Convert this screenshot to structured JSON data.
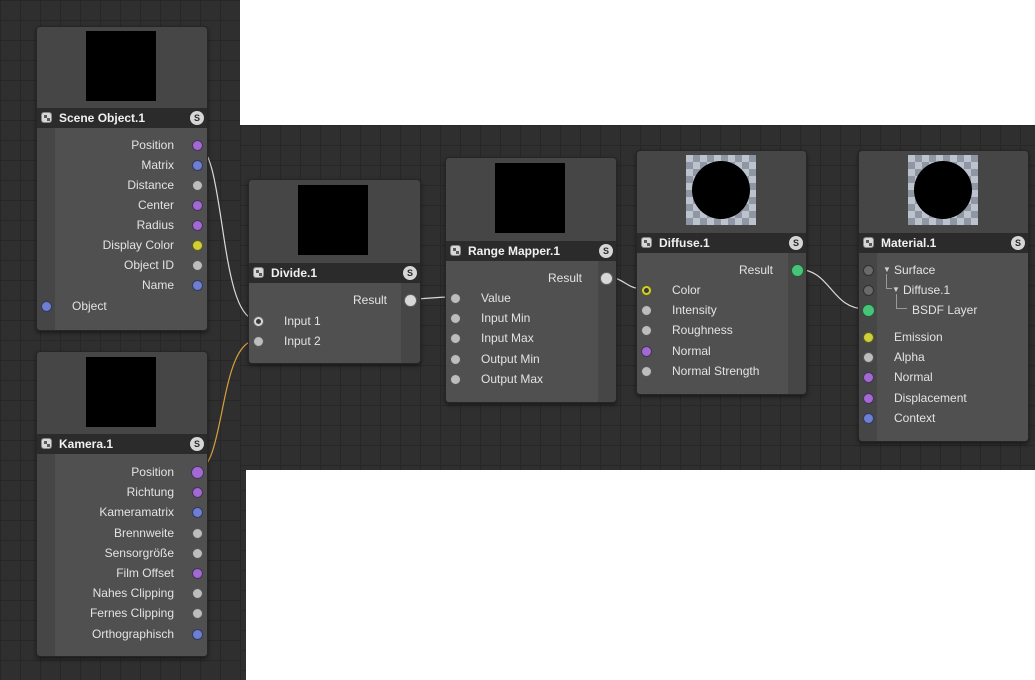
{
  "colors": {
    "port_purple": "#a06ad0",
    "port_blue": "#6e7ed0",
    "port_gray": "#bdbdbd",
    "port_yellow": "#cfcf3a",
    "port_green": "#48c47a",
    "wire_light": "#d9d9d9",
    "wire_orange": "#d9a03a",
    "node_bg": "#464646",
    "header_bg": "#2b2b2b",
    "canvas_bg": "#2f2f2f"
  },
  "nodes": {
    "scene_object": {
      "title": "Scene Object.1",
      "solo_label": "S",
      "icon": "node-type-icon",
      "outputs": [
        {
          "label": "Position",
          "color": "#a06ad0"
        },
        {
          "label": "Matrix",
          "color": "#6e7ed0"
        },
        {
          "label": "Distance",
          "color": "#bdbdbd"
        },
        {
          "label": "Center",
          "color": "#a06ad0"
        },
        {
          "label": "Radius",
          "color": "#a06ad0"
        },
        {
          "label": "Display Color",
          "color": "#cfcf3a"
        },
        {
          "label": "Object ID",
          "color": "#bdbdbd"
        },
        {
          "label": "Name",
          "color": "#6e7ed0"
        }
      ],
      "inputs": [
        {
          "label": "Object",
          "color": "#6e7ed0"
        }
      ]
    },
    "kamera": {
      "title": "Kamera.1",
      "solo_label": "S",
      "outputs": [
        {
          "label": "Position",
          "color": "#a06ad0",
          "big": true
        },
        {
          "label": "Richtung",
          "color": "#a06ad0"
        },
        {
          "label": "Kameramatrix",
          "color": "#6e7ed0"
        },
        {
          "label": "Brennweite",
          "color": "#bdbdbd"
        },
        {
          "label": "Sensorgröße",
          "color": "#bdbdbd"
        },
        {
          "label": "Film Offset",
          "color": "#a06ad0"
        },
        {
          "label": "Nahes Clipping",
          "color": "#bdbdbd"
        },
        {
          "label": "Fernes Clipping",
          "color": "#bdbdbd"
        },
        {
          "label": "Orthographisch",
          "color": "#6e7ed0"
        }
      ]
    },
    "divide": {
      "title": "Divide.1",
      "solo_label": "S",
      "result_label": "Result",
      "inputs": [
        {
          "label": "Input 1",
          "color": "#d8d8d8",
          "ring": true
        },
        {
          "label": "Input 2",
          "color": "#bdbdbd"
        }
      ]
    },
    "range_mapper": {
      "title": "Range Mapper.1",
      "solo_label": "S",
      "result_label": "Result",
      "inputs": [
        {
          "label": "Value",
          "color": "#bdbdbd"
        },
        {
          "label": "Input Min",
          "color": "#bdbdbd"
        },
        {
          "label": "Input Max",
          "color": "#bdbdbd"
        },
        {
          "label": "Output Min",
          "color": "#bdbdbd"
        },
        {
          "label": "Output Max",
          "color": "#bdbdbd"
        }
      ]
    },
    "diffuse": {
      "title": "Diffuse.1",
      "solo_label": "S",
      "result_label": "Result",
      "inputs": [
        {
          "label": "Color",
          "color": "#cfcf3a",
          "ring": true
        },
        {
          "label": "Intensity",
          "color": "#bdbdbd"
        },
        {
          "label": "Roughness",
          "color": "#bdbdbd"
        },
        {
          "label": "Normal",
          "color": "#a06ad0"
        },
        {
          "label": "Normal Strength",
          "color": "#bdbdbd"
        }
      ]
    },
    "material": {
      "title": "Material.1",
      "solo_label": "S",
      "surface_tree": [
        {
          "label": "Surface",
          "color": "#6a6a6a"
        },
        {
          "label": "Diffuse.1",
          "color": "#6a6a6a"
        },
        {
          "label": "BSDF Layer",
          "color": "#48c47a"
        }
      ],
      "inputs": [
        {
          "label": "Emission",
          "color": "#cfcf3a"
        },
        {
          "label": "Alpha",
          "color": "#bdbdbd"
        },
        {
          "label": "Normal",
          "color": "#a06ad0"
        },
        {
          "label": "Displacement",
          "color": "#a06ad0"
        },
        {
          "label": "Context",
          "color": "#6e7ed0"
        }
      ]
    }
  }
}
